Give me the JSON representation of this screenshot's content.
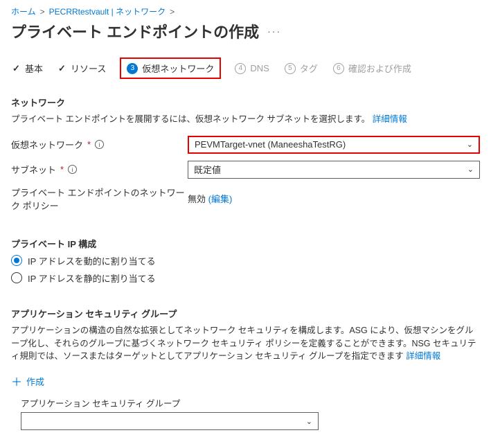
{
  "breadcrumb": {
    "home": "ホーム",
    "vault": "PECRRtestvault | ネットワーク"
  },
  "title": "プライベート エンドポイントの作成",
  "tabs": {
    "basics": "基本",
    "resource": "リソース",
    "vnet_num": "3",
    "vnet": "仮想ネットワーク",
    "dns_num": "4",
    "dns": "DNS",
    "tags_num": "5",
    "tags": "タグ",
    "review_num": "6",
    "review": "確認および作成"
  },
  "network": {
    "heading": "ネットワーク",
    "helper_text": "プライベート エンドポイントを展開するには、仮想ネットワーク サブネットを選択します。",
    "learn_more": "詳細情報",
    "vnet_label": "仮想ネットワーク",
    "vnet_value": "PEVMTarget-vnet (ManeeshaTestRG)",
    "subnet_label": "サブネット",
    "subnet_value": "既定値",
    "policy_label": "プライベート エンドポイントのネットワーク ポリシー",
    "policy_value": "無効",
    "policy_edit": "(編集)"
  },
  "ipconfig": {
    "heading": "プライベート IP 構成",
    "dynamic": "IP アドレスを動的に割り当てる",
    "static": "IP アドレスを静的に割り当てる"
  },
  "asg": {
    "heading": "アプリケーション セキュリティ グループ",
    "helper": "アプリケーションの構造の自然な拡張としてネットワーク セキュリティを構成します。ASG により、仮想マシンをグループ化し、それらのグループに基づくネットワーク セキュリティ ポリシーを定義することができます。NSG セキュリティ規則では、ソースまたはターゲットとしてアプリケーション セキュリティ グループを指定できます",
    "learn_more": "詳細情報",
    "create": "作成",
    "table_label": "アプリケーション セキュリティ グループ",
    "select_value": ""
  }
}
